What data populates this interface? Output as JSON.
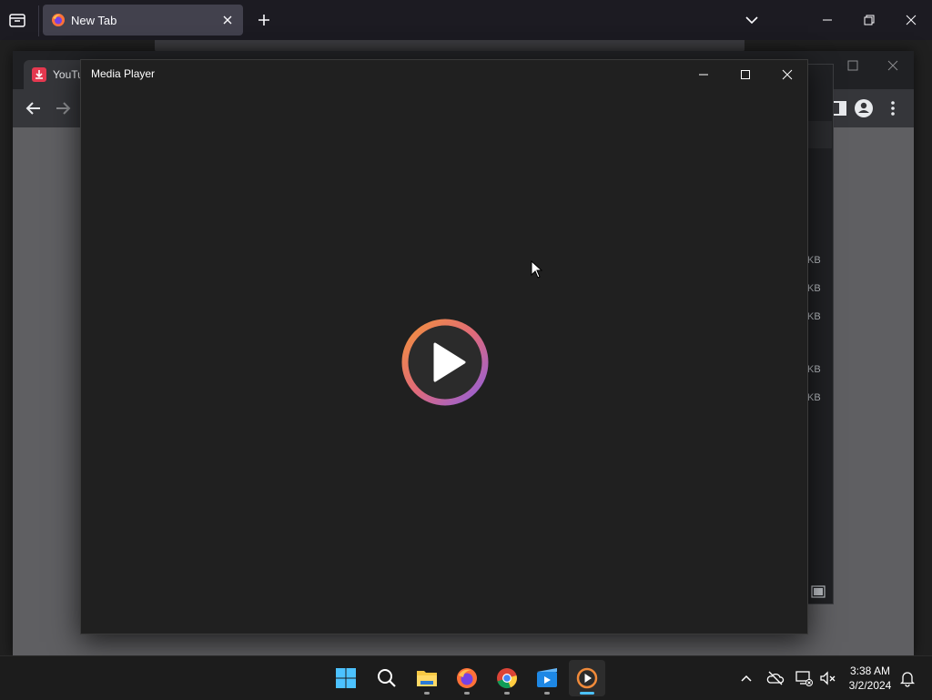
{
  "firefox": {
    "tab_title": "New Tab"
  },
  "chrome": {
    "tab_title": "YouTu",
    "download_sizes": [
      "KB",
      "KB",
      "KB",
      "KB",
      "KB"
    ]
  },
  "media_player": {
    "title": "Media Player",
    "icons": [
      "minimize-icon",
      "maximize-icon",
      "close-icon",
      "play-icon"
    ]
  },
  "taskbar": {
    "apps": [
      "start",
      "search",
      "file-explorer",
      "firefox",
      "chrome",
      "media-app",
      "media-player"
    ],
    "time": "3:38 AM",
    "date": "3/2/2024"
  },
  "colors": {
    "accent": "#4cc2ff",
    "play_gradient_start": "#f08a3a",
    "play_gradient_end": "#9b63d8"
  }
}
